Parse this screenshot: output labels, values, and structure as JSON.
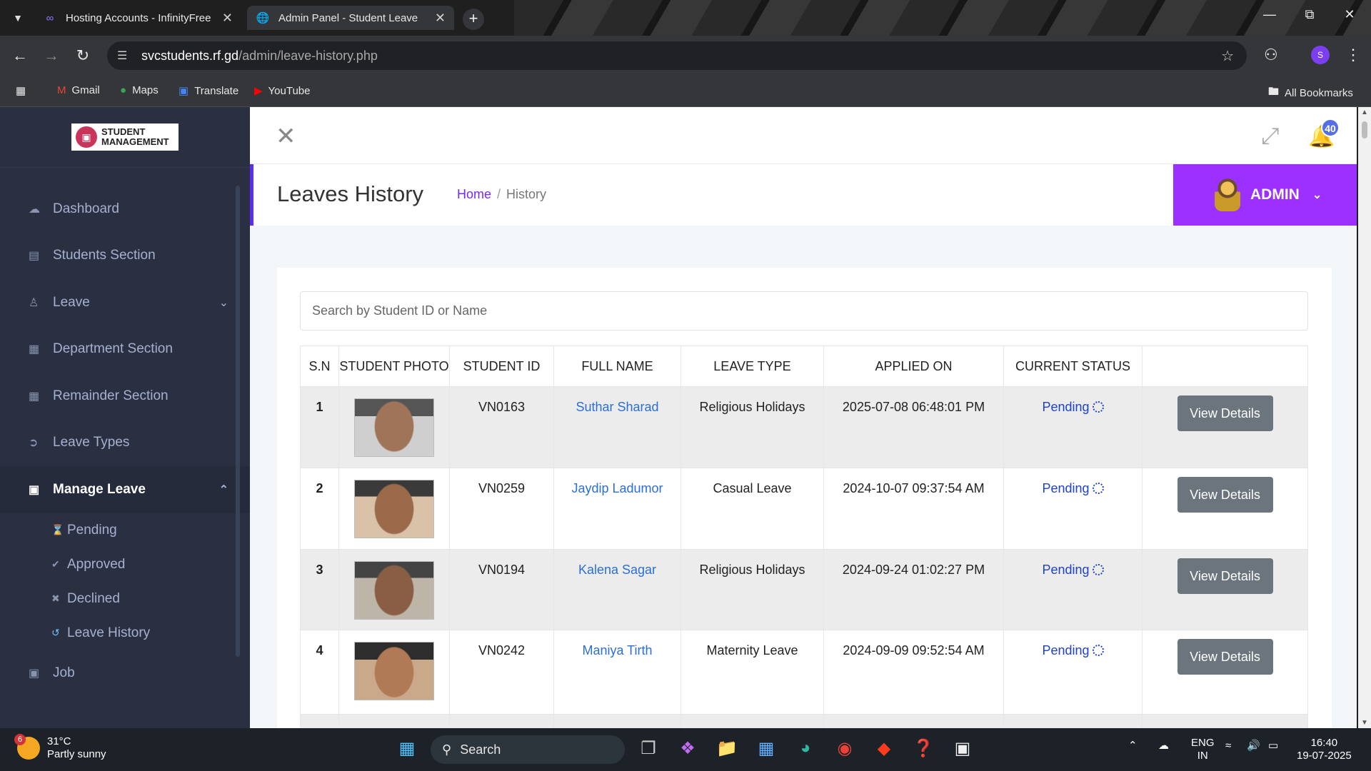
{
  "browser": {
    "tabs": [
      {
        "title": "Hosting Accounts - InfinityFree",
        "icon": "infinity-icon"
      },
      {
        "title": "Admin Panel - Student Leave",
        "icon": "globe-icon"
      }
    ],
    "url_host": "svcstudents.rf.gd",
    "url_path": "/admin/leave-history.php",
    "profile_initial": "S",
    "bookmarks": [
      "Gmail",
      "Maps",
      "Translate",
      "YouTube"
    ],
    "all_bookmarks": "All Bookmarks"
  },
  "sidebar": {
    "logo_line1": "STUDENT",
    "logo_line2": "MANAGEMENT",
    "items": [
      {
        "label": "Dashboard",
        "icon": "cloud-icon"
      },
      {
        "label": "Students Section",
        "icon": "id-card-icon"
      },
      {
        "label": "Leave",
        "icon": "user-icon"
      },
      {
        "label": "Department Section",
        "icon": "grid-icon"
      },
      {
        "label": "Remainder Section",
        "icon": "calendar-icon"
      },
      {
        "label": "Leave Types",
        "icon": "sign-out-icon"
      },
      {
        "label": "Manage Leave",
        "icon": "briefcase-icon"
      },
      {
        "label": "Job",
        "icon": "briefcase-icon"
      }
    ],
    "sub_items": [
      {
        "label": "Pending",
        "icon": "spinner-icon"
      },
      {
        "label": "Approved",
        "icon": "check-icon"
      },
      {
        "label": "Declined",
        "icon": "x-circle-icon"
      },
      {
        "label": "Leave History",
        "icon": "history-icon"
      }
    ]
  },
  "header": {
    "notification_count": "40",
    "page_title": "Leaves History",
    "breadcrumb_home": "Home",
    "breadcrumb_sep": "/",
    "breadcrumb_current": "History",
    "admin_label": "ADMIN"
  },
  "search": {
    "placeholder": "Search by Student ID or Name"
  },
  "table": {
    "headers": [
      "S.N",
      "STUDENT PHOTO",
      "STUDENT ID",
      "FULL NAME",
      "LEAVE TYPE",
      "APPLIED ON",
      "CURRENT STATUS",
      ""
    ],
    "rows": [
      {
        "sn": "1",
        "id": "VN0163",
        "name": "Suthar Sharad",
        "type": "Religious Holidays",
        "applied": "2025-07-08 06:48:01 PM",
        "status": "Pending",
        "action": "View Details"
      },
      {
        "sn": "2",
        "id": "VN0259",
        "name": "Jaydip Ladumor",
        "type": "Casual Leave",
        "applied": "2024-10-07 09:37:54 AM",
        "status": "Pending",
        "action": "View Details"
      },
      {
        "sn": "3",
        "id": "VN0194",
        "name": "Kalena Sagar",
        "type": "Religious Holidays",
        "applied": "2024-09-24 01:02:27 PM",
        "status": "Pending",
        "action": "View Details"
      },
      {
        "sn": "4",
        "id": "VN0242",
        "name": "Maniya Tirth",
        "type": "Maternity Leave",
        "applied": "2024-09-09 09:52:54 AM",
        "status": "Pending",
        "action": "View Details"
      }
    ]
  },
  "taskbar": {
    "weather_badge": "6",
    "temp": "31°C",
    "condition": "Partly sunny",
    "search_label": "Search",
    "lang1": "ENG",
    "lang2": "IN",
    "time": "16:40",
    "date": "19-07-2025"
  },
  "colors": {
    "accent": "#9b30ff",
    "sidebar": "#2a3042",
    "link": "#2b6fd6",
    "button": "#6c757d"
  }
}
